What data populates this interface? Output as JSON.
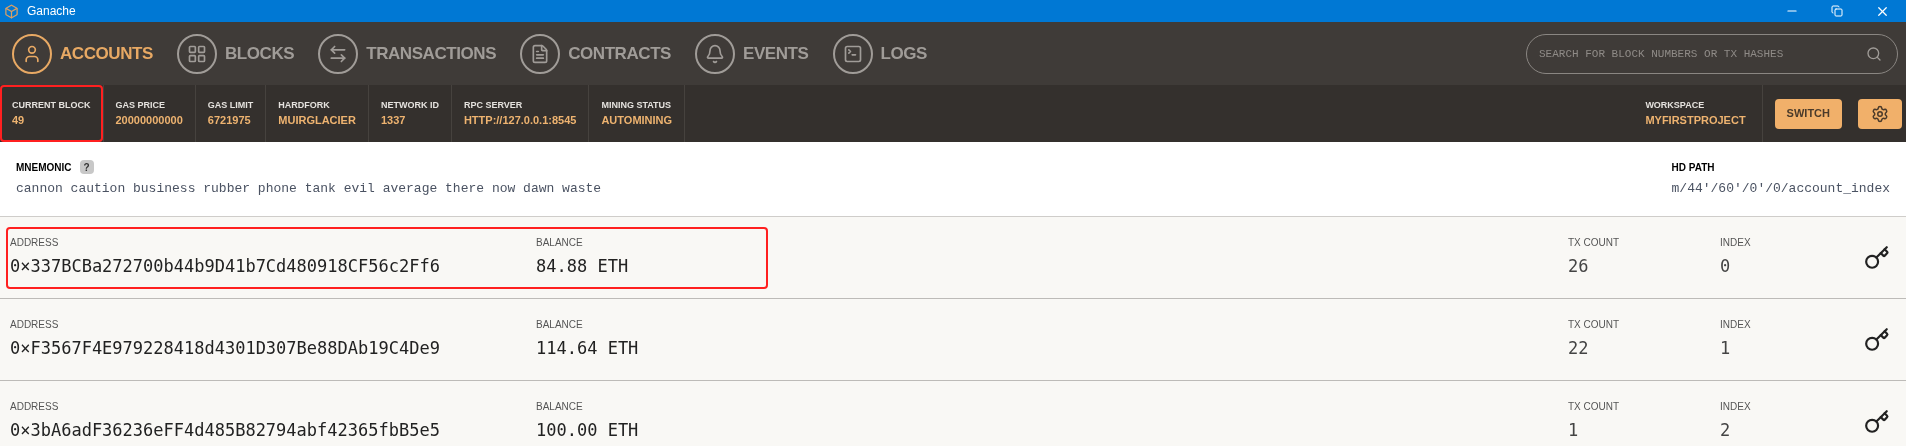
{
  "window": {
    "title": "Ganache"
  },
  "nav": [
    {
      "label": "ACCOUNTS",
      "kind": "accounts",
      "selected": true
    },
    {
      "label": "BLOCKS",
      "kind": "blocks",
      "selected": false
    },
    {
      "label": "TRANSACTIONS",
      "kind": "transactions",
      "selected": false
    },
    {
      "label": "CONTRACTS",
      "kind": "contracts",
      "selected": false
    },
    {
      "label": "EVENTS",
      "kind": "events",
      "selected": false
    },
    {
      "label": "LOGS",
      "kind": "logs",
      "selected": false
    }
  ],
  "search": {
    "placeholder": "SEARCH FOR BLOCK NUMBERS OR TX HASHES"
  },
  "stats": [
    {
      "label": "CURRENT BLOCK",
      "value": "49",
      "highlighted": true
    },
    {
      "label": "GAS PRICE",
      "value": "20000000000",
      "highlighted": false
    },
    {
      "label": "GAS LIMIT",
      "value": "6721975",
      "highlighted": false
    },
    {
      "label": "HARDFORK",
      "value": "MUIRGLACIER",
      "highlighted": false
    },
    {
      "label": "NETWORK ID",
      "value": "1337",
      "highlighted": false
    },
    {
      "label": "RPC SERVER",
      "value": "HTTP://127.0.0.1:8545",
      "highlighted": false
    },
    {
      "label": "MINING STATUS",
      "value": "AUTOMINING",
      "highlighted": false
    }
  ],
  "workspace": {
    "label": "WORKSPACE",
    "value": "MYFIRSTPROJECT"
  },
  "switch_button": "SWITCH",
  "mnemonic": {
    "label": "MNEMONIC",
    "help": "?",
    "words": "cannon caution business rubber phone tank evil average there now dawn waste"
  },
  "hd_path": {
    "label": "HD PATH",
    "value": "m/44'/60'/0'/0/account_index"
  },
  "accounts": [
    {
      "address_label": "ADDRESS",
      "address": "0×337BCBa272700b44b9D41b7Cd480918CF56c2Ff6",
      "balance_label": "BALANCE",
      "balance": "84.88 ETH",
      "tx_count_label": "TX COUNT",
      "tx_count": "26",
      "index_label": "INDEX",
      "index": "0",
      "highlighted": true
    },
    {
      "address_label": "ADDRESS",
      "address": "0×F3567F4E979228418d4301D307Be88DAb19C4De9",
      "balance_label": "BALANCE",
      "balance": "114.64 ETH",
      "tx_count_label": "TX COUNT",
      "tx_count": "22",
      "index_label": "INDEX",
      "index": "1",
      "highlighted": false
    },
    {
      "address_label": "ADDRESS",
      "address": "0×3bA6adF36236eFF4d485B82794abf42365fbB5e5",
      "balance_label": "BALANCE",
      "balance": "100.00 ETH",
      "tx_count_label": "TX COUNT",
      "tx_count": "1",
      "index_label": "INDEX",
      "index": "2",
      "highlighted": false
    }
  ]
}
